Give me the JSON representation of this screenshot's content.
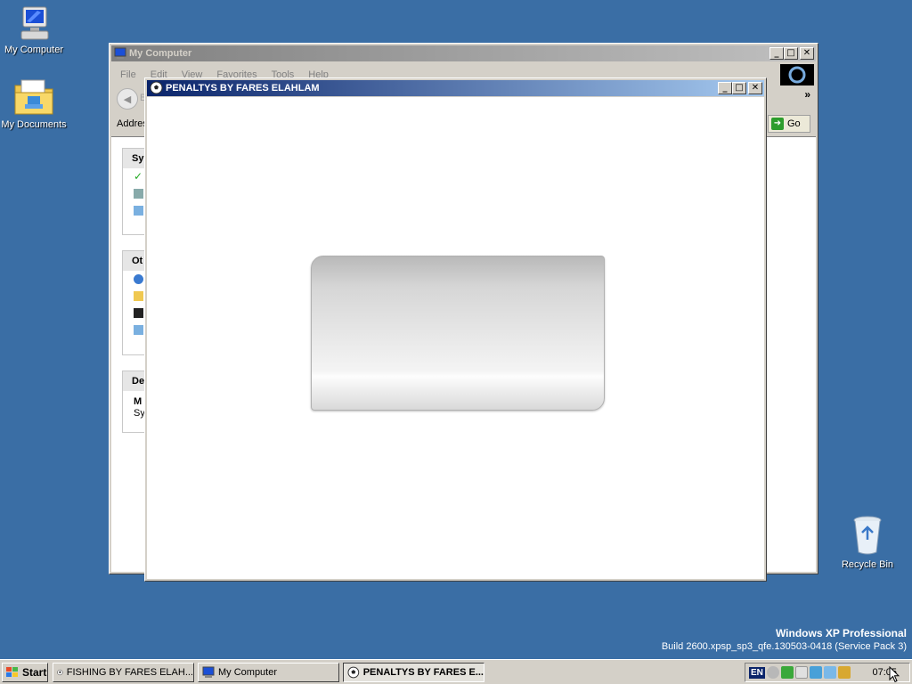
{
  "desktop": {
    "icons": [
      {
        "label": "My Computer",
        "icon": "my-computer-icon"
      },
      {
        "label": "My Documents",
        "icon": "my-documents-icon"
      },
      {
        "label": "Recycle Bin",
        "icon": "recycle-bin-icon"
      }
    ],
    "watermark": {
      "line1": "Windows XP Professional",
      "line2": "Build 2600.xpsp_sp3_qfe.130503-0418 (Service Pack 3)"
    }
  },
  "window_back": {
    "title": "My Computer",
    "menu": [
      "File",
      "Edit",
      "View",
      "Favorites",
      "Tools",
      "Help"
    ],
    "back_label": "B",
    "address_label": "Address",
    "go_label": "Go",
    "chevron": "»",
    "panels": [
      {
        "header": "Sy"
      },
      {
        "header": "Ot"
      },
      {
        "header": "De",
        "lines": [
          "M",
          "Sy"
        ]
      }
    ]
  },
  "window_front": {
    "title": "PENALTYS BY FARES ELAHLAM"
  },
  "controls": {
    "minimize": "_",
    "maximize": "□",
    "close": "✕"
  },
  "taskbar": {
    "start_label": "Start",
    "tasks": [
      {
        "label": "FISHING BY FARES ELAH...",
        "active": false
      },
      {
        "label": "My Computer",
        "active": false
      },
      {
        "label": "PENALTYS BY FARES E...",
        "active": true
      }
    ],
    "language": "EN",
    "clock": "07:05"
  }
}
